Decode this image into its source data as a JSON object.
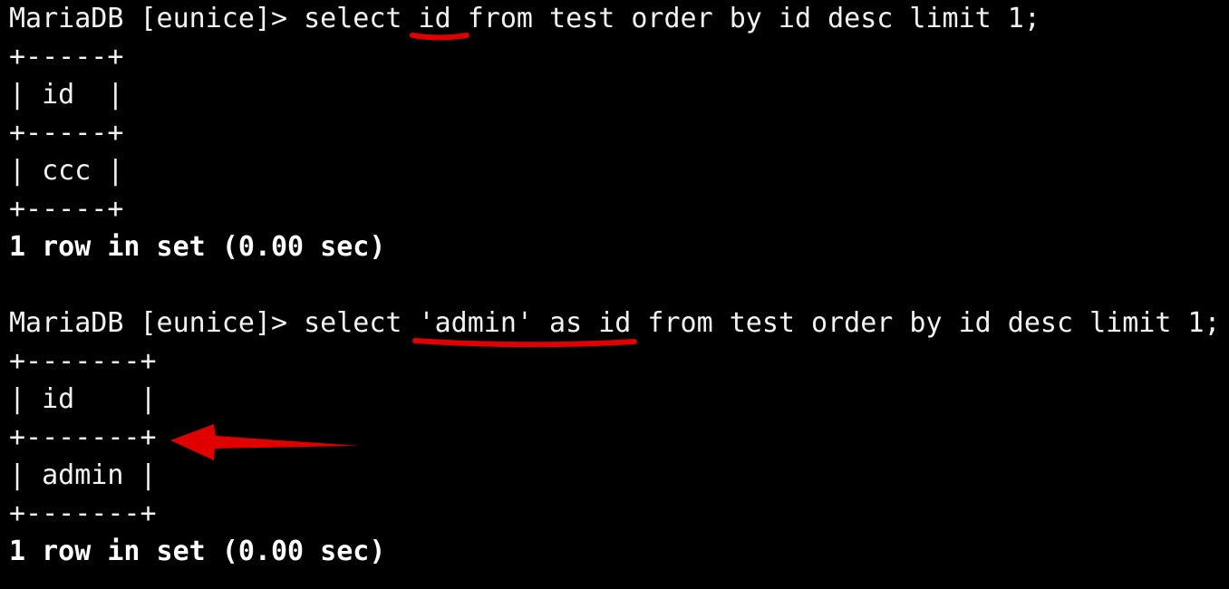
{
  "terminal": {
    "block1": {
      "prompt": "MariaDB [eunice]> ",
      "cmd_a": "select ",
      "cmd_b": "id",
      "cmd_c": " from test order by id desc limit 1;",
      "border": "+-----+",
      "header": "| id  |",
      "row": "| ccc |",
      "status": "1 row in set (0.00 sec)"
    },
    "block2": {
      "prompt": "MariaDB [eunice]> ",
      "cmd_a": "select ",
      "cmd_b": "'admin' as id",
      "cmd_c": " from test order by id desc limit 1;",
      "border": "+-------+",
      "header": "| id    |",
      "row": "| admin |",
      "status": "1 row in set (0.00 sec)"
    }
  },
  "annotation_color": "#e00000"
}
